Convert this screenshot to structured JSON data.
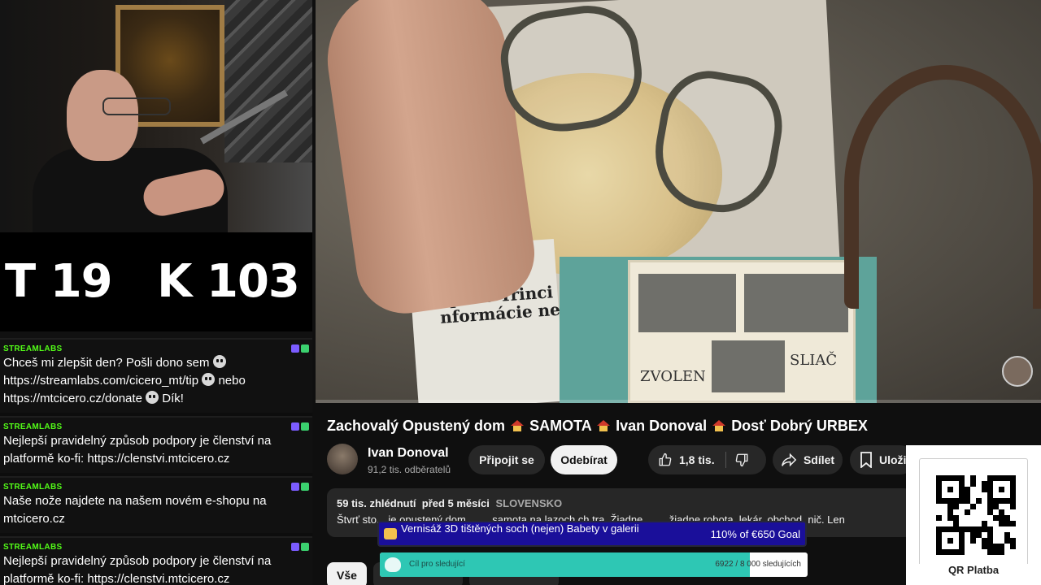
{
  "score": {
    "text": "T 19   K 103"
  },
  "chat": {
    "messages": [
      {
        "author": "STREAMLABS",
        "parts": [
          "Chceš mi zlepšit den? Pošli dono sem",
          "https://streamlabs.com/cicero_mt/tip",
          "nebo",
          "https://mtcicero.cz/donate",
          "Dík!"
        ]
      },
      {
        "author": "STREAMLABS",
        "text": "Nejlepší pravidelný způsob podpory je členství na platformě ko-fi: https://clenstvi.mtcicero.cz"
      },
      {
        "author": "STREAMLABS",
        "text": "Naše nože najdete na našem novém e-shopu na mtcicero.cz"
      },
      {
        "author": "STREAMLABS",
        "text": "Nejlepší pravidelný způsob podpory je členství na platformě ko-fi: https://clenstvi.mtcicero.cz"
      }
    ]
  },
  "video": {
    "newspaper_headline": "apuí v Třinci\nnformácie nedáte",
    "postcard_cities": [
      "ZVOLEN",
      "SLIAČ"
    ]
  },
  "title_parts": [
    "Zachovalý Opustený dom",
    "SAMOTA",
    "Ivan Donoval",
    "Dosť Dobrý URBEX"
  ],
  "channel": {
    "name": "Ivan Donoval",
    "subscribers": "91,2 tis. odběratelů"
  },
  "actions": {
    "join": "Připojit se",
    "subscribe": "Odebírat",
    "likes": "1,8 tis.",
    "share": "Sdílet",
    "save": "Uloži"
  },
  "description": {
    "views": "59 tis. zhlédnutí",
    "date": "před 5 měsíci",
    "tag": "SLOVENSKO",
    "text": "Štvrť sto... je opustený dom ... ... samota na lazoch ch.tra. Žiadne ... ... žiadne robota, lekár, obchod, nič. Len"
  },
  "chips": [
    "Vše"
  ],
  "goal": {
    "title": "Vernisáž 3D tištěných soch (nejen) Babety v galerii",
    "amount": "110% of €650 Goal"
  },
  "follow_goal": {
    "label": "Cíl pro sledující",
    "count": "6922 / 8 000 sledujících",
    "progress": 0.865
  },
  "qr": {
    "label": "QR Platba"
  },
  "colors": {
    "youtube_bg": "#0f0f0f",
    "chip_bg": "#272727",
    "streamlabs_green": "#53fc18",
    "goal_blue": "#1a0f9a",
    "follow_teal": "#2ec7b4"
  }
}
